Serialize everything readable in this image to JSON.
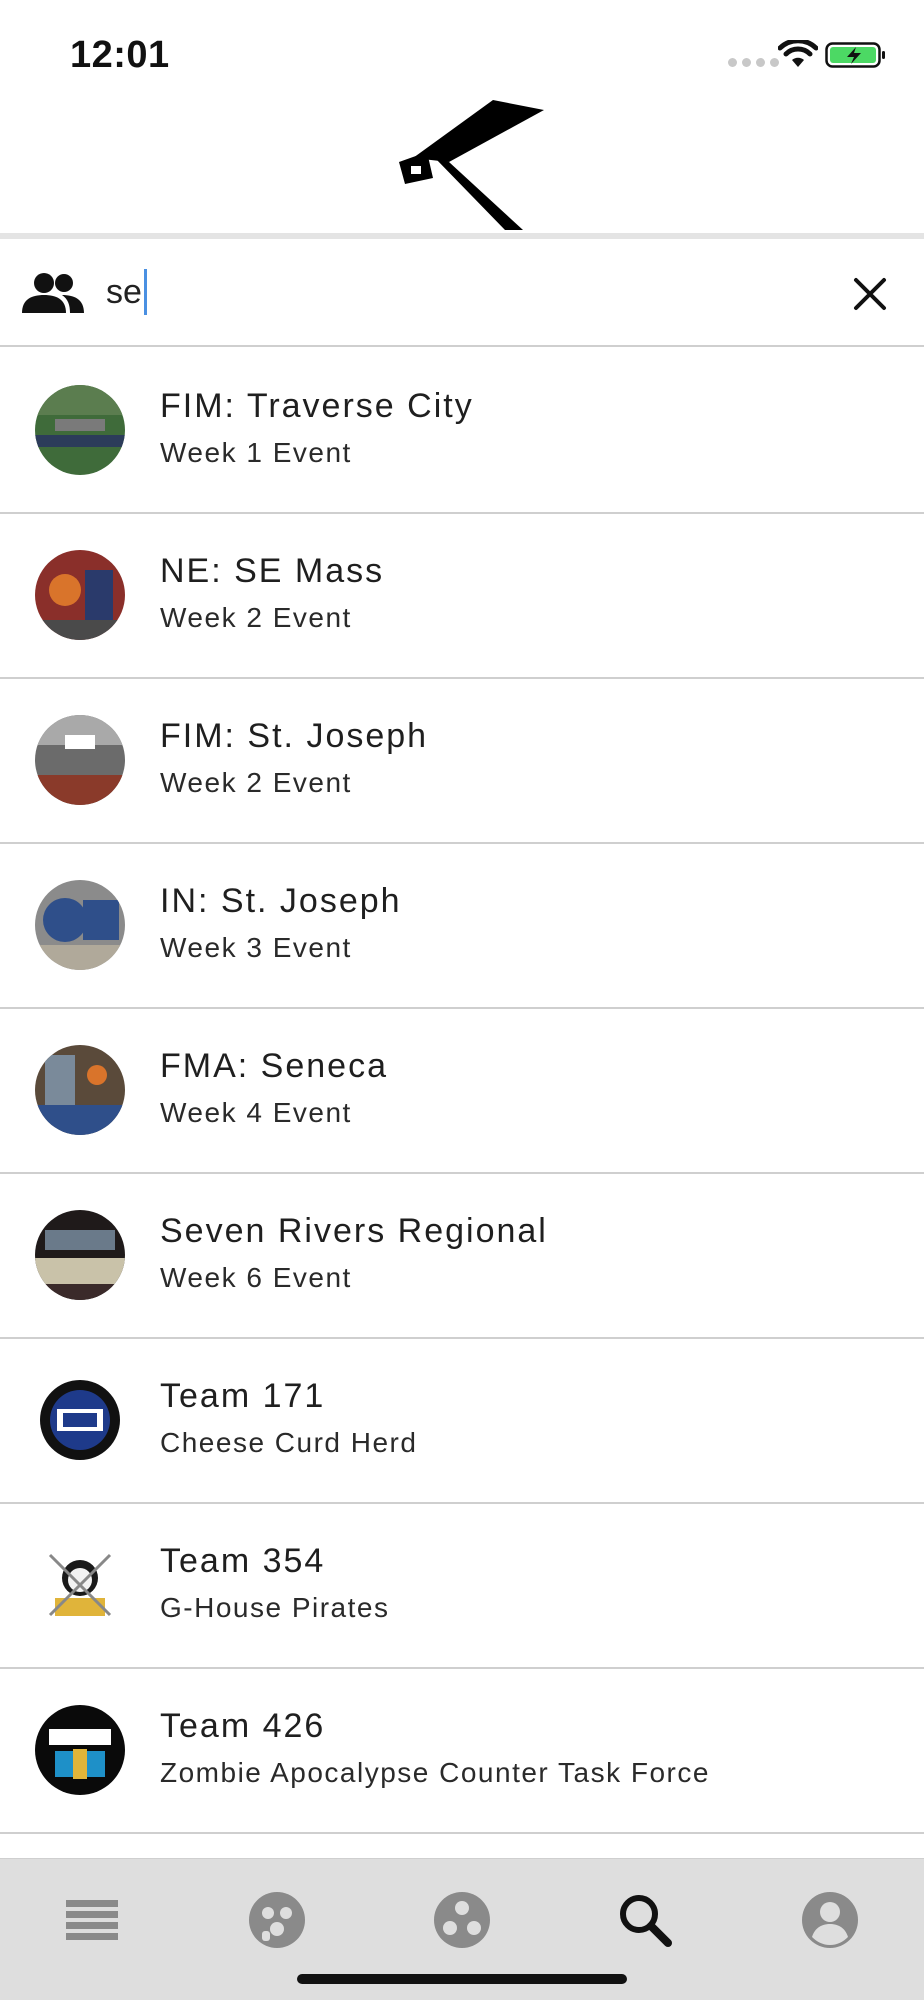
{
  "status_bar": {
    "time": "12:01"
  },
  "search": {
    "query": "se"
  },
  "results": [
    {
      "title": "FIM: Traverse City",
      "subtitle": "Week 1 Event",
      "avatar_color": "#3f6b3a"
    },
    {
      "title": "NE: SE Mass",
      "subtitle": "Week 2 Event",
      "avatar_color": "#8a2f2a"
    },
    {
      "title": "FIM: St. Joseph",
      "subtitle": "Week 2 Event",
      "avatar_color": "#6b6b6b"
    },
    {
      "title": "IN: St. Joseph",
      "subtitle": "Week 3 Event",
      "avatar_color": "#2f4f8a"
    },
    {
      "title": "FMA: Seneca",
      "subtitle": "Week 4 Event",
      "avatar_color": "#5a4a3a"
    },
    {
      "title": "Seven Rivers Regional",
      "subtitle": "Week 6 Event",
      "avatar_color": "#3a2a2a"
    },
    {
      "title": "Team 171",
      "subtitle": "Cheese Curd Herd",
      "avatar_color": "#1e3a8a"
    },
    {
      "title": "Team 354",
      "subtitle": "G-House Pirates",
      "avatar_color": "#f2e9c9"
    },
    {
      "title": "Team 426",
      "subtitle": "Zombie Apocalypse Counter Task Force",
      "avatar_color": "#0a0a0a"
    }
  ],
  "bottom_nav": [
    {
      "icon": "menu-icon",
      "active": false
    },
    {
      "icon": "events-icon",
      "active": false
    },
    {
      "icon": "teams-icon",
      "active": false
    },
    {
      "icon": "search-icon",
      "active": true
    },
    {
      "icon": "account-icon",
      "active": false
    }
  ],
  "colors": {
    "caret": "#4a90e2",
    "nav_background": "#dedede",
    "nav_inactive": "#8a8a8a",
    "nav_active": "#111111",
    "battery": "#4cd964"
  }
}
